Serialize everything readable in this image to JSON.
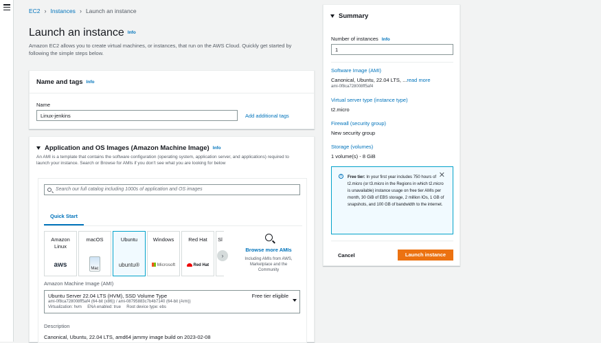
{
  "breadcrumb": {
    "root": "EC2",
    "section": "Instances",
    "current": "Launch an instance"
  },
  "page": {
    "title": "Launch an instance",
    "info": "Info",
    "description": "Amazon EC2 allows you to create virtual machines, or instances, that run on the AWS Cloud. Quickly get started by following the simple steps below."
  },
  "name_tags": {
    "title": "Name and tags",
    "info": "Info",
    "name_label": "Name",
    "name_value": "Linux-jenkins",
    "add_tags": "Add additional tags"
  },
  "ami": {
    "title": "Application and OS Images (Amazon Machine Image)",
    "info": "Info",
    "description": "An AMI is a template that contains the software configuration (operating system, application server, and applications) required to launch your instance. Search or Browse for AMIs if you don't see what you are looking for below",
    "search_placeholder": "Search our full catalog including 1000s of application and OS images",
    "quick_start_tab": "Quick Start",
    "os_tiles": [
      {
        "name": "Amazon Linux",
        "logo": "aws"
      },
      {
        "name": "macOS",
        "logo": "Mac"
      },
      {
        "name": "Ubuntu",
        "logo": "ubuntu®"
      },
      {
        "name": "Windows",
        "logo": "Microsoft"
      },
      {
        "name": "Red Hat",
        "logo": "Red Hat"
      },
      {
        "name": "Sl",
        "logo": ""
      }
    ],
    "selected_os": "Ubuntu",
    "browse_more": "Browse more AMIs",
    "browse_desc": "Including AMIs from AWS, Marketplace and the Community",
    "ami_label": "Amazon Machine Image (AMI)",
    "selected_ami": {
      "title": "Ubuntu Server 22.04 LTS (HVM), SSD Volume Type",
      "ids": "ami-0f8ca728008ff5af4 (64-bit (x86)) / ami-08795883c7b4b7140 (64-bit (Arm))",
      "details": "Virtualization: hvm     ENA enabled: true     Root device type: ebs",
      "free_tier": "Free tier eligible"
    },
    "desc_label": "Description",
    "desc_value": "Canonical, Ubuntu, 22.04 LTS, amd64 jammy image build on 2023-02-08"
  },
  "summary": {
    "title": "Summary",
    "instances_label": "Number of instances",
    "instances_info": "Info",
    "instances_value": "1",
    "software_label": "Software Image (AMI)",
    "software_value": "Canonical, Ubuntu, 22.04 LTS, ...",
    "read_more": "read more",
    "software_id": "ami-0f8ca728008ff5af4",
    "server_label": "Virtual server type (instance type)",
    "server_value": "t2.micro",
    "firewall_label": "Firewall (security group)",
    "firewall_value": "New security group",
    "storage_label": "Storage (volumes)",
    "storage_value": "1 volume(s) - 8 GiB",
    "free_tier_title": "Free tier:",
    "free_tier_text": " In your first year includes 750 hours of t2.micro (or t3.micro in the Regions in which t2.micro is unavailable) instance usage on free tier AMIs per month, 30 GiB of EBS storage, 2 million IOs, 1 GB of snapshots, and 100 GB of bandwidth to the internet.",
    "cancel": "Cancel",
    "launch": "Launch instance"
  },
  "colors": {
    "accent": "#0073bb",
    "launch": "#ec7211",
    "info_bg": "#f1faff"
  }
}
